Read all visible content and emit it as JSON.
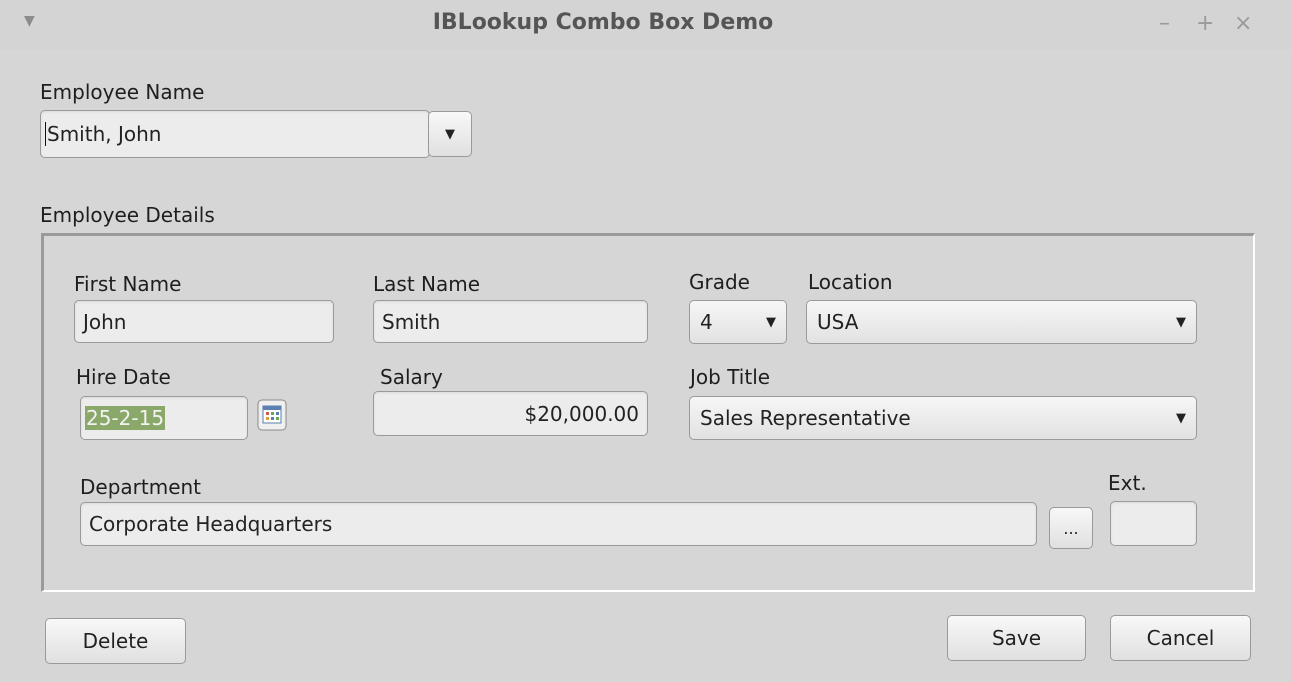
{
  "window": {
    "title": "IBLookup Combo Box Demo",
    "menu_glyph": "▼",
    "controls": {
      "minimize": "–",
      "maximize": "+",
      "close": "×"
    }
  },
  "employee_name": {
    "label": "Employee Name",
    "value": "Smith, John",
    "dropdown_glyph": "▼"
  },
  "details": {
    "group_label": "Employee Details",
    "first_name": {
      "label": "First Name",
      "value": "John"
    },
    "last_name": {
      "label": "Last Name",
      "value": "Smith"
    },
    "grade": {
      "label": "Grade",
      "value": "4"
    },
    "location": {
      "label": "Location",
      "value": "USA"
    },
    "hire_date": {
      "label": "Hire Date",
      "value": "25-2-15"
    },
    "salary": {
      "label": "Salary",
      "value": "$20,000.00"
    },
    "job_title": {
      "label": "Job Title",
      "value": "Sales Representative"
    },
    "department": {
      "label": "Department",
      "value": "Corporate Headquarters",
      "browse_label": "..."
    },
    "ext": {
      "label": "Ext.",
      "value": ""
    }
  },
  "buttons": {
    "delete": "Delete",
    "save": "Save",
    "cancel": "Cancel"
  },
  "colors": {
    "background": "#d6d6d6",
    "field": "#ececec",
    "selection": "#8aa86a",
    "border": "#9a9a9a"
  },
  "icons": [
    "menu-arrow-icon",
    "minimize-icon",
    "maximize-icon",
    "close-icon",
    "chevron-down-icon",
    "calendar-icon"
  ]
}
